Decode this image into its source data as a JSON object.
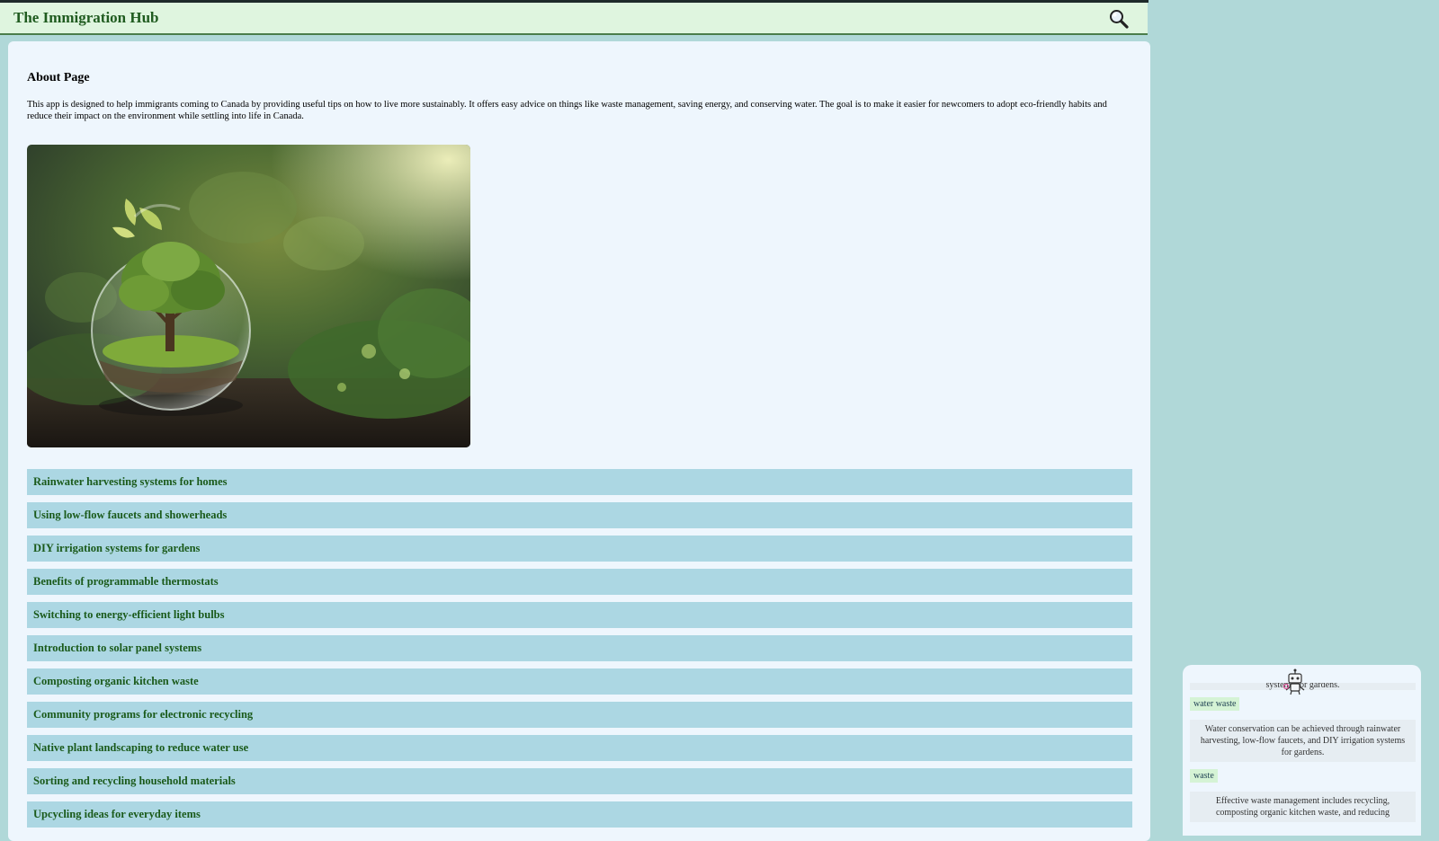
{
  "header": {
    "title": "The Immigration Hub",
    "search_icon": "magnifier-icon"
  },
  "about": {
    "heading": "About Page",
    "description": "This app is designed to help immigrants coming to Canada by providing useful tips on how to live more sustainably. It offers easy advice on things like waste management, saving energy, and conserving water. The goal is to make it easier for newcomers to adopt eco-friendly habits and reduce their impact on the environment while settling into life in Canada."
  },
  "topics": [
    {
      "label": "Rainwater harvesting systems for homes"
    },
    {
      "label": "Using low-flow faucets and showerheads"
    },
    {
      "label": "DIY irrigation systems for gardens"
    },
    {
      "label": "Benefits of programmable thermostats"
    },
    {
      "label": "Switching to energy-efficient light bulbs"
    },
    {
      "label": "Introduction to solar panel systems"
    },
    {
      "label": "Composting organic kitchen waste"
    },
    {
      "label": "Community programs for electronic recycling"
    },
    {
      "label": "Native plant landscaping to reduce water use"
    },
    {
      "label": "Sorting and recycling household materials"
    },
    {
      "label": "Upcycling ideas for everyday items"
    }
  ],
  "chat": {
    "avatar_icon": "robot-icon",
    "partial_top": "systems for gardens.",
    "messages": [
      {
        "role": "user",
        "text": "water waste"
      },
      {
        "role": "bot",
        "text": "Water conservation can be achieved through rainwater harvesting, low-flow faucets, and DIY irrigation systems for gardens."
      },
      {
        "role": "user",
        "text": "waste"
      },
      {
        "role": "bot",
        "text": "Effective waste management includes recycling, composting organic kitchen waste, and reducing"
      }
    ]
  },
  "colors": {
    "header_bg": "#dff5df",
    "brand_green": "#1f5b1f",
    "card_bg": "#eef6fd",
    "topic_bg": "#acd7e3",
    "page_bg": "#b0d8d8"
  }
}
